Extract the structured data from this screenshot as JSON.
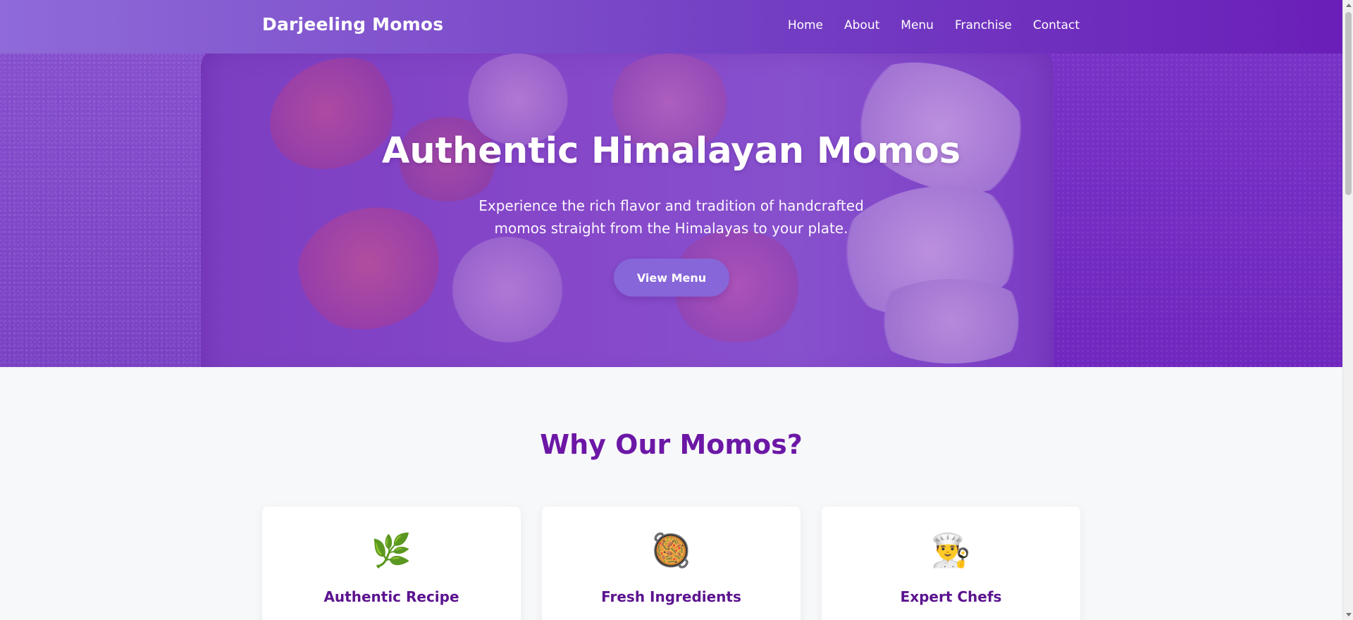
{
  "header": {
    "brand": "Darjeeling Momos",
    "nav": [
      "Home",
      "About",
      "Menu",
      "Franchise",
      "Contact"
    ]
  },
  "hero": {
    "title": "Authentic Himalayan Momos",
    "subtitle": "Experience the rich flavor and tradition of handcrafted momos straight from the Himalayas to your plate.",
    "button": "View Menu"
  },
  "features": {
    "title": "Why Our Momos?",
    "cards": [
      {
        "icon": "🌿",
        "icon_name": "leaf-icon",
        "title": "Authentic Recipe"
      },
      {
        "icon": "🥘",
        "icon_name": "pan-icon",
        "title": "Fresh Ingredients"
      },
      {
        "icon": "👨‍🍳",
        "icon_name": "chef-icon",
        "title": "Expert Chefs"
      }
    ]
  },
  "colors": {
    "primary": "#6c17a6",
    "header_start": "#8f6ad8",
    "header_end": "#6a1fb8",
    "button": "#8666d8"
  }
}
